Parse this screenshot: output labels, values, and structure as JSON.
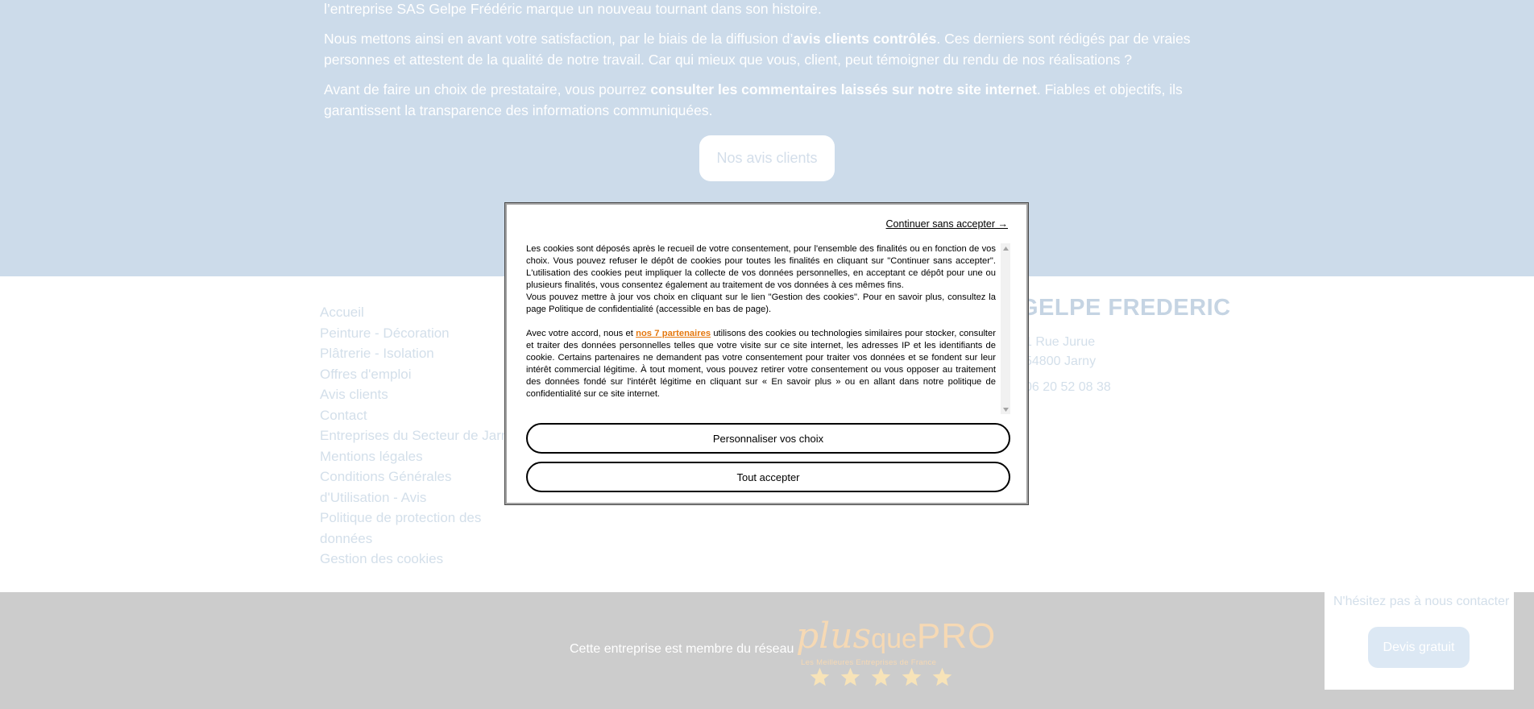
{
  "intro": {
    "line0": "l’entreprise SAS Gelpe Frédéric marque un nouveau tournant dans son histoire.",
    "p1_start": "Nous mettons ainsi en avant votre satisfaction, par le biais de la diffusion d’",
    "p1_bold": "avis clients contrôlés",
    "p1_end": ". Ces derniers sont rédigés par de vraies personnes et attestent de la qualité de notre travail. Car qui mieux que vous, client, peut témoigner du rendu de nos réalisations ?",
    "p2_start": "Avant de faire un choix de prestataire, vous pourrez ",
    "p2_bold": "consulter les commentaires laissés sur notre site internet",
    "p2_end": ". Fiables et objectifs, ils garantissent la transparence des informations communiquées.",
    "button_label": "Nos avis clients"
  },
  "footer": {
    "nav": [
      "Accueil",
      "Peinture - Décoration",
      "Plâtrerie - Isolation",
      "Offres d'emploi",
      "Avis clients",
      "Contact",
      "Entreprises du Secteur de Jarny",
      "Mentions légales",
      "Conditions Générales d'Utilisation - Avis",
      "Politique de protection des données",
      "Gestion des cookies"
    ],
    "company_name": "GELPE FREDERIC",
    "address_line1": "1 Rue Jurue",
    "address_line2": "54800 Jarny",
    "phone": "06 20 52 08 38"
  },
  "bottom": {
    "member_text": "Cette entreprise est membre du réseau",
    "logo_plus": "plus",
    "logo_que": "que",
    "logo_pro": "PRO",
    "logo_tagline": "Les Meilleures Entreprises de France",
    "star_count": 5,
    "star_color": "#f7e3b8"
  },
  "contact_widget": {
    "text": "N'hésitez pas à nous contacter",
    "button_label": "Devis gratuit"
  },
  "cookie_modal": {
    "continue_label": "Continuer sans accepter →",
    "para1": "Les cookies sont déposés après le recueil de votre consentement, pour l'ensemble des finalités ou en fonction de vos choix. Vous pouvez refuser le dépôt de cookies pour toutes les finalités en cliquant sur \"Continuer sans accepter\". L'utilisation des cookies peut impliquer la collecte de vos données personnelles, en acceptant ce dépôt pour une ou plusieurs finalités, vous consentez également au traitement de vos données à ces mêmes fins.",
    "para2": "Vous pouvez mettre à jour vos choix en cliquant sur le lien \"Gestion des cookies\". Pour en savoir plus, consultez la page Politique de confidentialité (accessible en bas de page).",
    "para3_start": "Avec votre accord, nous et ",
    "partners_link": "nos 7 partenaires",
    "para3_end": " utilisons des cookies ou technologies similaires pour stocker, consulter et traiter des données personnelles telles que votre visite sur ce site internet, les adresses IP et les identifiants de cookie. Certains partenaires ne demandent pas votre consentement pour traiter vos données et se fondent sur leur intérêt commercial légitime. À tout moment, vous pouvez retirer votre consentement ou vous opposer au traitement des données fondé sur l'intérêt légitime en cliquant sur « En savoir plus » ou en allant dans notre politique de confidentialité sur ce site internet.",
    "customize_label": "Personnaliser vos choix",
    "accept_label": "Tout accepter",
    "link_color": "#e5780f"
  }
}
